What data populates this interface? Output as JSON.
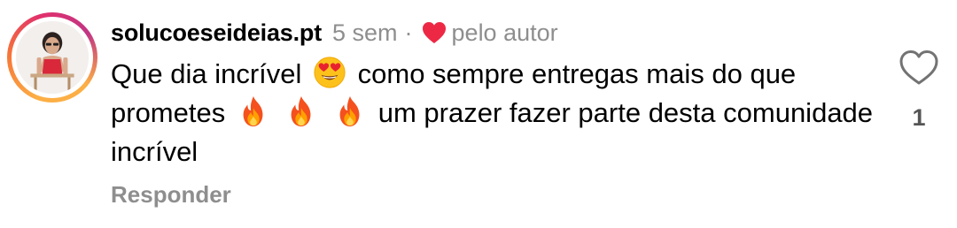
{
  "comment": {
    "author": {
      "username": "solucoeseideias.pt",
      "avatar_icon": "profile-photo-avatar",
      "ring_colors": [
        "#fcaf45",
        "#f77737",
        "#e1306c",
        "#c13584"
      ]
    },
    "time_ago": "5 sem",
    "separator": "·",
    "liked_by_author": {
      "icon": "heart-filled-icon",
      "color": "#ed2845",
      "label": "pelo autor"
    },
    "text_segments": {
      "part1": "Que dia incrível",
      "part2": "como sempre entregas mais do que prometes",
      "part3": "um prazer fazer parte desta comunidade incrível"
    },
    "emojis": {
      "heart_eyes": "heart-eyes-emoji",
      "fire": "fire-emoji",
      "fire_count": 3
    },
    "reply_label": "Responder",
    "like": {
      "icon": "heart-outline-icon",
      "count": "1"
    }
  },
  "colors": {
    "text": "#000000",
    "secondary_text": "#8e8e8e",
    "like_count": "#555555",
    "liked_heart": "#ed2845"
  }
}
